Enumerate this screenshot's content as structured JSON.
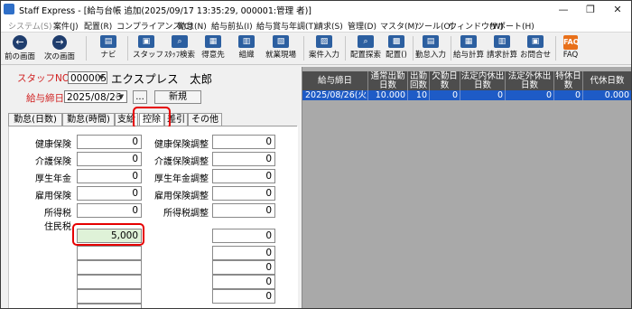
{
  "window": {
    "title": "Staff Express - [給与台帳 追加(2025/09/17 13:35:29, 000001:管理  者)]",
    "minimize": "—",
    "restore": "❐",
    "close": "✕"
  },
  "menu": [
    "システム(S)",
    "案件(J)",
    "配置(R)",
    "コンプライアンス(C)",
    "勤怠(N)",
    "給与前払(I)",
    "給与賞与年調(T)",
    "請求(S)",
    "管理(D)",
    "マスタ(M)",
    "ツール(O)",
    "ウィンドウ(W)",
    "サポート(H)"
  ],
  "toolbar": {
    "buttons": [
      {
        "label": "前の画面",
        "icon": "back-icon",
        "glyph": "←"
      },
      {
        "label": "次の画面",
        "icon": "forward-icon",
        "glyph": "→"
      },
      {
        "label": "ナビ",
        "icon": "navi-icon",
        "glyph": "▤"
      },
      {
        "label": "スタッフ",
        "icon": "staff-icon",
        "glyph": "▣"
      },
      {
        "label": "ｽﾀｯﾌ検索",
        "icon": "staff-search-icon",
        "glyph": "⌕"
      },
      {
        "label": "得意先",
        "icon": "client-icon",
        "glyph": "▦"
      },
      {
        "label": "組織",
        "icon": "organization-icon",
        "glyph": "▥"
      },
      {
        "label": "就業現場",
        "icon": "workplace-icon",
        "glyph": "▧"
      },
      {
        "label": "案件入力",
        "icon": "job-entry-icon",
        "glyph": "▨"
      },
      {
        "label": "配置探索",
        "icon": "placement-search-icon",
        "glyph": "⌕"
      },
      {
        "label": "配置()",
        "icon": "placement-icon",
        "glyph": "▩"
      },
      {
        "label": "勤怠入力",
        "icon": "attendance-entry-icon",
        "glyph": "▤"
      },
      {
        "label": "給与計算",
        "icon": "payroll-calc-icon",
        "glyph": "▦"
      },
      {
        "label": "請求計算",
        "icon": "billing-calc-icon",
        "glyph": "▥"
      },
      {
        "label": "お問合せ",
        "icon": "inquiry-icon",
        "glyph": "▣"
      },
      {
        "label": "FAQ",
        "icon": "faq-icon",
        "glyph": "FAQ"
      }
    ]
  },
  "header": {
    "staff_no_label": "スタッフNO",
    "staff_no_value": "000005",
    "staff_name": "エクスプレス　太郎",
    "payday_label": "給与締日",
    "payday_value": "2025/08/26",
    "ellipsis_button": "...",
    "new_button": "新規"
  },
  "tabs": [
    {
      "label": "勤怠(日数)",
      "active": false
    },
    {
      "label": "勤怠(時間)",
      "active": false
    },
    {
      "label": "支給",
      "active": false
    },
    {
      "label": "控除",
      "active": true
    },
    {
      "label": "差引",
      "active": false
    },
    {
      "label": "その他",
      "active": false
    }
  ],
  "deductions_left": [
    {
      "label": "健康保険",
      "value": "0"
    },
    {
      "label": "介護保険",
      "value": "0"
    },
    {
      "label": "厚生年金",
      "value": "0"
    },
    {
      "label": "雇用保険",
      "value": "0"
    },
    {
      "label": "所得税",
      "value": "0"
    },
    {
      "label": "住民税",
      "value": "5,000"
    },
    {
      "label": "",
      "value": ""
    },
    {
      "label": "",
      "value": ""
    },
    {
      "label": "",
      "value": ""
    },
    {
      "label": "",
      "value": ""
    },
    {
      "label": "",
      "value": ""
    }
  ],
  "deductions_right": [
    {
      "label": "健康保険調整",
      "value": "0"
    },
    {
      "label": "介護保険調整",
      "value": "0"
    },
    {
      "label": "厚生年金調整",
      "value": "0"
    },
    {
      "label": "雇用保険調整",
      "value": "0"
    },
    {
      "label": "所得税調整",
      "value": "0"
    }
  ],
  "extra_right_values": [
    "0",
    "0",
    "0",
    "0",
    "0"
  ],
  "grid": {
    "columns": [
      "給与締日",
      "通常出勤日数",
      "出勤回数",
      "欠勤日数",
      "法定内休出日数",
      "法定外休出日数",
      "特休日数",
      "代休日数"
    ],
    "rows": [
      [
        "2025/08/26(火)",
        "10.000",
        "10",
        "0",
        "0",
        "0",
        "0",
        "0.000"
      ]
    ]
  },
  "colors": {
    "accent_red": "#e60000",
    "selected_row": "#1e5bc6",
    "grid_header": "#4d4d4d",
    "resident_tax_bg": "#dff2d8"
  }
}
